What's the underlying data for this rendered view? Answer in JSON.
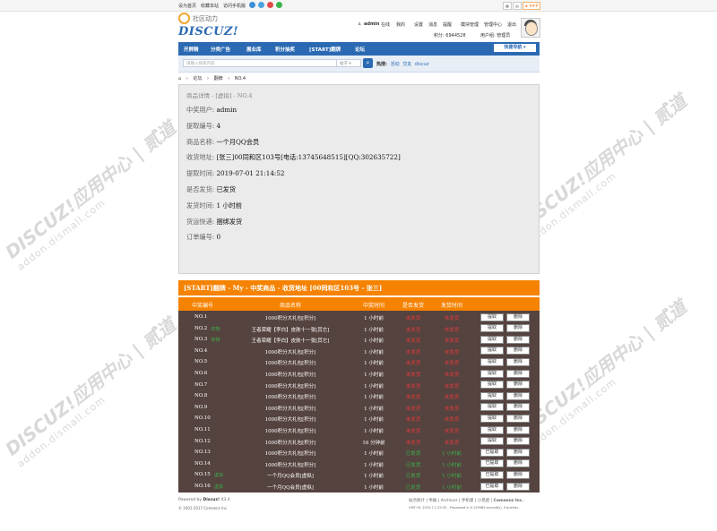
{
  "topbar": {
    "links": [
      "设为首页",
      "收藏本站",
      "访问手机版"
    ],
    "right_buttons": [
      "",
      "",
      "&#9733;2.0"
    ],
    "badge": "★ ###"
  },
  "header": {
    "logo_sub": "社区动力",
    "logo_main": "DISCUZ!",
    "user_links": [
      "admin",
      "在线",
      "我的",
      "设置",
      "消息",
      "提醒",
      "模块管理",
      "管理中心",
      "退出"
    ],
    "points": "积分: 6944528",
    "group": "用户组: 管理员"
  },
  "nav": {
    "items": [
      "开屏精",
      "分类广告",
      "展业库",
      "积分抽奖",
      "[START]翻牌",
      "论坛"
    ],
    "quick_nav": "快捷导航"
  },
  "search": {
    "placeholder": "请输入搜索内容",
    "type": "帖子",
    "hot_label": "热搜:",
    "hot_items": [
      "活动",
      "交友",
      "discuz"
    ]
  },
  "breadcrumb": [
    "论坛",
    "翻牌",
    "NO.4"
  ],
  "panel": {
    "title": "商品详情 - [虚拟] - NO.4",
    "lines": [
      {
        "label": "中奖用户: ",
        "value": "admin"
      },
      {
        "label": "提取编号: ",
        "value": "4"
      },
      {
        "label": "商品名称: ",
        "value": "一个月QQ会员"
      },
      {
        "label": "收货地址: ",
        "value": "[张三]00同和区103号[电话:13745648515][QQ:302635722]"
      },
      {
        "label": "提取时间: ",
        "value": "2019-07-01 21:14:52"
      },
      {
        "label": "是否发货: ",
        "value": "已发货"
      },
      {
        "label": "发货时间: ",
        "value": "1 小时前"
      },
      {
        "label": "货运快递: ",
        "value": "捆绑发货"
      },
      {
        "label": "订单编号: ",
        "value": "0"
      }
    ]
  },
  "table": {
    "title": "[START]翻牌 - My - 中奖商品 - 收货地址 [00同和区103号 - 张三]",
    "headers": [
      "中奖编号",
      "商品名称",
      "中奖时间",
      "是否发货",
      "发货时间"
    ],
    "rows": [
      {
        "no": "NO.1",
        "tag": "",
        "name": "1000积分大礼包[积分]",
        "time": "1 小时前",
        "ship": "未发货",
        "ship_time": "未发货",
        "shipped": false,
        "btn1": "提取",
        "btn2": "删除"
      },
      {
        "no": "NO.2",
        "tag": "实物",
        "name": "王者荣耀【李白】皮肤十一张[其它]",
        "time": "1 小时前",
        "ship": "未发货",
        "ship_time": "未发货",
        "shipped": false,
        "btn1": "提取",
        "btn2": "删除"
      },
      {
        "no": "NO.3",
        "tag": "实物",
        "name": "王者荣耀【李白】皮肤十一张[其它]",
        "time": "1 小时前",
        "ship": "未发货",
        "ship_time": "未发货",
        "shipped": false,
        "btn1": "提取",
        "btn2": "删除"
      },
      {
        "no": "NO.4",
        "tag": "",
        "name": "1000积分大礼包[积分]",
        "time": "1 小时前",
        "ship": "未发货",
        "ship_time": "未发货",
        "shipped": false,
        "btn1": "提取",
        "btn2": "删除"
      },
      {
        "no": "NO.5",
        "tag": "",
        "name": "1000积分大礼包[积分]",
        "time": "1 小时前",
        "ship": "未发货",
        "ship_time": "未发货",
        "shipped": false,
        "btn1": "提取",
        "btn2": "删除"
      },
      {
        "no": "NO.6",
        "tag": "",
        "name": "1000积分大礼包[积分]",
        "time": "1 小时前",
        "ship": "未发货",
        "ship_time": "未发货",
        "shipped": false,
        "btn1": "提取",
        "btn2": "删除"
      },
      {
        "no": "NO.7",
        "tag": "",
        "name": "1000积分大礼包[积分]",
        "time": "1 小时前",
        "ship": "未发货",
        "ship_time": "未发货",
        "shipped": false,
        "btn1": "提取",
        "btn2": "删除"
      },
      {
        "no": "NO.8",
        "tag": "",
        "name": "1000积分大礼包[积分]",
        "time": "1 小时前",
        "ship": "未发货",
        "ship_time": "未发货",
        "shipped": false,
        "btn1": "提取",
        "btn2": "删除"
      },
      {
        "no": "NO.9",
        "tag": "",
        "name": "1000积分大礼包[积分]",
        "time": "1 小时前",
        "ship": "未发货",
        "ship_time": "未发货",
        "shipped": false,
        "btn1": "提取",
        "btn2": "删除"
      },
      {
        "no": "NO.10",
        "tag": "",
        "name": "1000积分大礼包[积分]",
        "time": "1 小时前",
        "ship": "未发货",
        "ship_time": "未发货",
        "shipped": false,
        "btn1": "提取",
        "btn2": "删除"
      },
      {
        "no": "NO.11",
        "tag": "",
        "name": "1000积分大礼包[积分]",
        "time": "1 小时前",
        "ship": "未发货",
        "ship_time": "未发货",
        "shipped": false,
        "btn1": "提取",
        "btn2": "删除"
      },
      {
        "no": "NO.12",
        "tag": "",
        "name": "1000积分大礼包[积分]",
        "time": "16 分钟前",
        "ship": "未发货",
        "ship_time": "未发货",
        "shipped": false,
        "btn1": "提取",
        "btn2": "删除"
      },
      {
        "no": "NO.13",
        "tag": "",
        "name": "1000积分大礼包[积分]",
        "time": "1 小时前",
        "ship": "已发货",
        "ship_time": "1 小时前",
        "shipped": true,
        "btn1": "已提取",
        "btn2": "删除"
      },
      {
        "no": "NO.14",
        "tag": "",
        "name": "1000积分大礼包[积分]",
        "time": "1 小时前",
        "ship": "已发货",
        "ship_time": "1 小时前",
        "shipped": true,
        "btn1": "已提取",
        "btn2": "删除"
      },
      {
        "no": "NO.15",
        "tag": "虚拟",
        "name": "一个月QQ会员[虚拟]",
        "time": "1 小时前",
        "ship": "已发货",
        "ship_time": "1 小时前",
        "shipped": true,
        "btn1": "已提取",
        "btn2": "删除"
      },
      {
        "no": "NO.16",
        "tag": "虚拟",
        "name": "一个月QQ会员[虚拟]",
        "time": "1 小时前",
        "ship": "已发货",
        "ship_time": "1 小时前",
        "shipped": true,
        "btn1": "已提取",
        "btn2": "删除"
      }
    ]
  },
  "footer": {
    "powered": "Powered by",
    "product": "Discuz!",
    "version": "X3.4",
    "copyright": "© 2001-2017 Comsenz Inc.",
    "links": [
      "站点统计",
      "举报",
      "Archiver",
      "手机版",
      "小黑屋",
      "Comsenz Inc."
    ],
    "stats": "GMT+8, 2019-7-1 22:35 , Processed in 0.129989 second(s), 9 queries ."
  },
  "watermark": {
    "main": "DISCUZ!应用中心 | 贰道",
    "sub": "addon.dismall.com"
  }
}
